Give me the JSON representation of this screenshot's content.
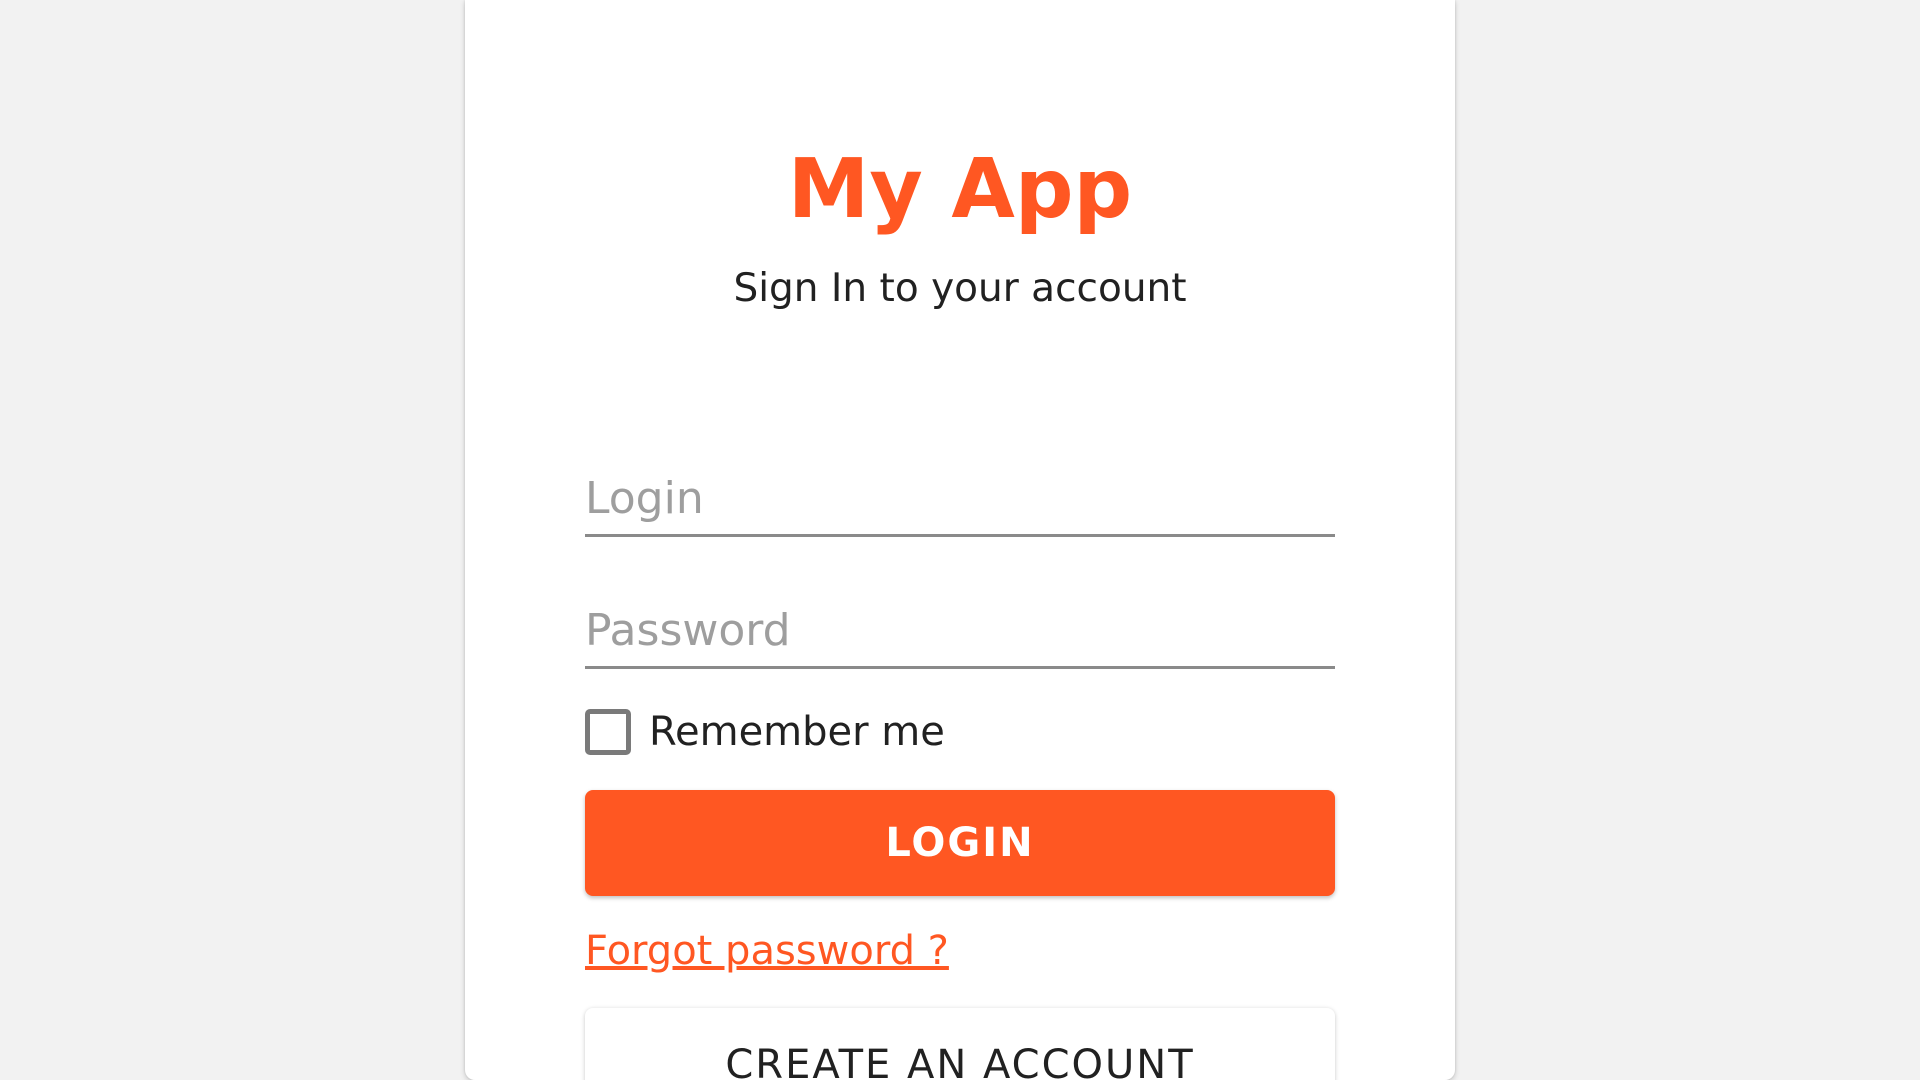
{
  "app": {
    "title": "My App",
    "subtitle": "Sign In to your account"
  },
  "form": {
    "login_placeholder": "Login",
    "login_value": "",
    "password_placeholder": "Password",
    "password_value": "",
    "remember_label": "Remember me",
    "remember_checked": false,
    "login_button": "LOGIN",
    "forgot_link": "Forgot password ?",
    "create_button": "CREATE AN ACCOUNT"
  },
  "colors": {
    "accent": "#ff5722",
    "background": "#f2f2f2",
    "card": "#ffffff",
    "text": "#212121",
    "placeholder": "#9e9e9e"
  }
}
